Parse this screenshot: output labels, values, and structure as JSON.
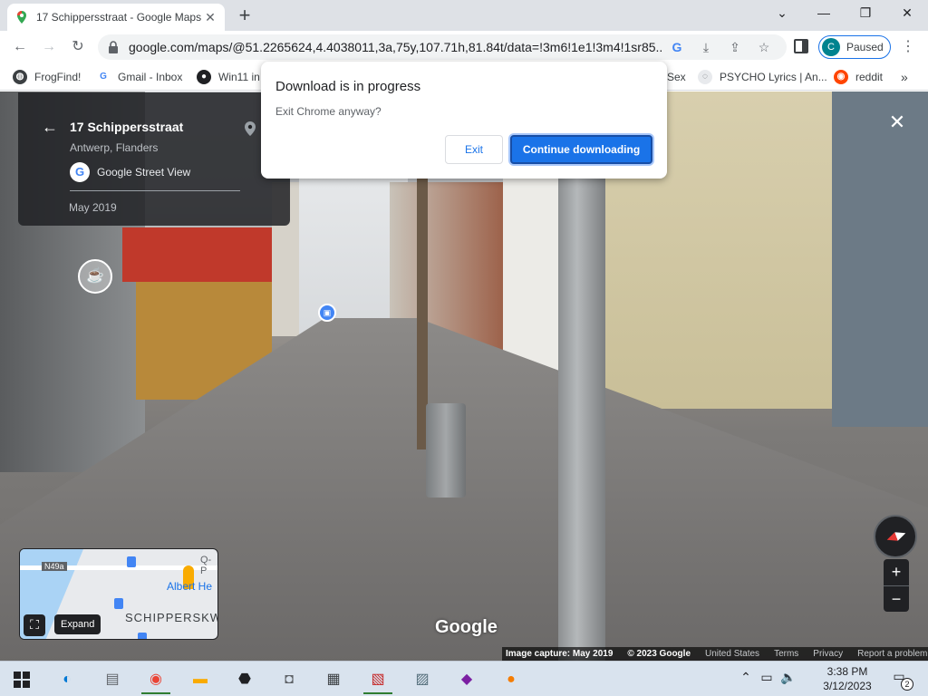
{
  "browser": {
    "tab_title": "17 Schippersstraat - Google Maps",
    "url": "google.com/maps/@51.2265624,4.4038011,3a,75y,107.71h,81.84t/data=!3m6!1e1!3m4!1sr85...",
    "profile_initial": "C",
    "profile_status": "Paused",
    "bookmarks": [
      {
        "label": "FrogFind!"
      },
      {
        "label": "Gmail - Inbox"
      },
      {
        "label": "Win11 in"
      },
      {
        "label": "Sex"
      },
      {
        "label": "PSYCHO Lyrics | An..."
      },
      {
        "label": "reddit"
      }
    ]
  },
  "dialog": {
    "title": "Download is in progress",
    "message": "Exit Chrome anyway?",
    "exit_label": "Exit",
    "continue_label": "Continue downloading"
  },
  "infocard": {
    "place": "17 Schippersstraat",
    "region": "Antwerp, Flanders",
    "source": "Google Street View",
    "date": "May 2019"
  },
  "minimap": {
    "road_label": "N49a",
    "poi_label": "Albert He",
    "corner_label": "Q-P",
    "street_label": "SCHIPPERSKW",
    "expand_tooltip": "Expand"
  },
  "streetview": {
    "watermark": "Google"
  },
  "footer": {
    "capture": "Image capture: May 2019",
    "copyright": "© 2023 Google",
    "country": "United States",
    "terms": "Terms",
    "privacy": "Privacy",
    "report": "Report a problem"
  },
  "taskbar": {
    "time": "3:38 PM",
    "date": "3/12/2023",
    "notifications": "2"
  },
  "colors": {
    "accent": "#1a73e8",
    "infocard_bg": "#202124",
    "taskbar_bg": "#d9e3ee"
  }
}
